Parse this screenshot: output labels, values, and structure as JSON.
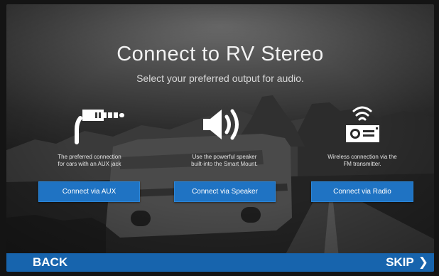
{
  "page": {
    "title": "Connect to RV Stereo",
    "subtitle": "Select your preferred output for audio."
  },
  "options": [
    {
      "icon": "aux-jack-icon",
      "description_line1": "The preferred connection",
      "description_line2": "for cars with an AUX jack",
      "button_label": "Connect via AUX"
    },
    {
      "icon": "speaker-icon",
      "description_line1": "Use the powerful speaker",
      "description_line2": "built-into the Smart Mount.",
      "button_label": "Connect via Speaker"
    },
    {
      "icon": "fm-radio-icon",
      "description_line1": "Wireless connection via the",
      "description_line2": "FM transmitter.",
      "button_label": "Connect via Radio"
    }
  ],
  "nav": {
    "back_label": "BACK",
    "skip_label": "SKIP",
    "skip_icon": "chevron-right-icon"
  },
  "colors": {
    "button_blue": "#1f73c3",
    "bar_blue": "#1764ad",
    "text": "#ffffff"
  }
}
